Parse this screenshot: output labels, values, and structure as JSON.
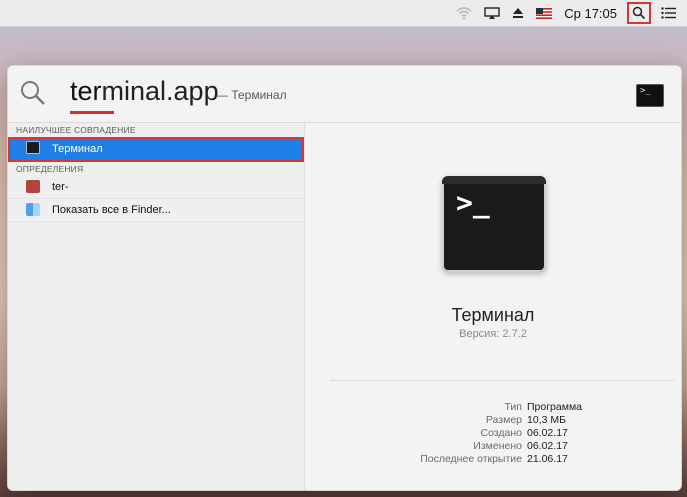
{
  "menubar": {
    "icons": [
      "wifi-icon",
      "airplay-icon",
      "eject-icon",
      "flag-icon",
      "search-icon",
      "list-icon"
    ],
    "clock": "Ср 17:05"
  },
  "spotlight": {
    "query_typed": "ter",
    "query_rest": "minal.app",
    "query_hint": "— Терминал"
  },
  "results": {
    "sections": [
      {
        "title": "НАИЛУЧШЕЕ СОВПАДЕНИЕ",
        "items": [
          {
            "label": "Терминал",
            "icon": "terminal-icon",
            "selected": true
          }
        ]
      },
      {
        "title": "ОПРЕДЕЛЕНИЯ",
        "items": [
          {
            "label": "ter-",
            "icon": "dictionary-icon"
          },
          {
            "label": "Показать все в Finder...",
            "icon": "finder-icon"
          }
        ]
      }
    ]
  },
  "preview": {
    "name": "Терминал",
    "version": "Версия: 2.7.2",
    "meta": [
      {
        "key": "Тип",
        "value": "Программа"
      },
      {
        "key": "Размер",
        "value": "10,3 МБ"
      },
      {
        "key": "Создано",
        "value": "06.02.17"
      },
      {
        "key": "Изменено",
        "value": "06.02.17"
      },
      {
        "key": "Последнее открытие",
        "value": "21.06.17"
      }
    ]
  },
  "colors": {
    "selection": "#1e7fe6",
    "highlight_border": "#dd3333"
  }
}
